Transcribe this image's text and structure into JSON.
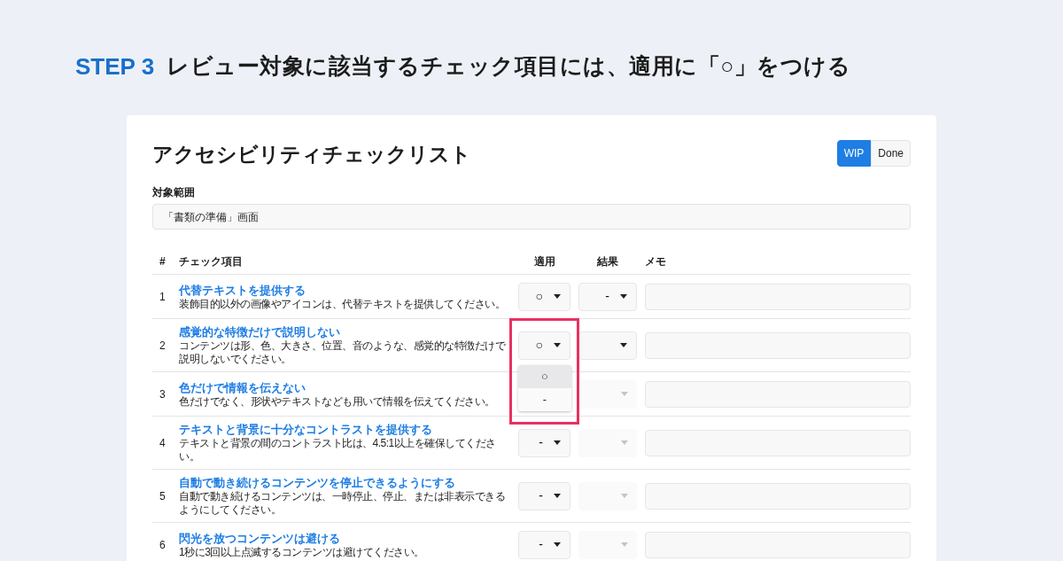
{
  "heading": {
    "step": "STEP 3",
    "text": "レビュー対象に該当するチェック項目には、適用に「○」をつける"
  },
  "card": {
    "title": "アクセシビリティチェックリスト",
    "status_toggle": [
      {
        "label": "WIP",
        "selected": true
      },
      {
        "label": "Done",
        "selected": false
      }
    ],
    "scope": {
      "label": "対象範囲",
      "value": "「書類の準備」画面"
    },
    "columns": [
      "#",
      "チェック項目",
      "適用",
      "結果",
      "メモ"
    ],
    "rows": [
      {
        "number": "1",
        "title": "代替テキストを提供する",
        "description": "装飾目的以外の画像やアイコンは、代替テキストを提供してください。",
        "apply": {
          "value": "○"
        },
        "result": {
          "value": "-",
          "disabled": false
        }
      },
      {
        "number": "2",
        "title": "感覚的な特徴だけで説明しない",
        "description": "コンテンツは形、色、大きさ、位置、音のような、感覚的な特徴だけで説明しないでください。",
        "apply": {
          "value": "○",
          "open": true,
          "highlighted": true,
          "options": [
            {
              "label": "○",
              "selected": true
            },
            {
              "label": "-",
              "selected": false
            }
          ]
        },
        "result": {
          "disabled": false
        }
      },
      {
        "number": "3",
        "title": "色だけで情報を伝えない",
        "description": "色だけでなく、形状やテキストなども用いて情報を伝えてください。",
        "result": {
          "disabled": true
        }
      },
      {
        "number": "4",
        "title": "テキストと背景に十分なコントラストを提供する",
        "description": "テキストと背景の間のコントラスト比は、4.5:1以上を確保してください。",
        "apply": {
          "value": "-"
        },
        "result": {
          "disabled": true
        }
      },
      {
        "number": "5",
        "title": "自動で動き続けるコンテンツを停止できるようにする",
        "description": "自動で動き続けるコンテンツは、一時停止、停止、または非表示できるようにしてください。",
        "apply": {
          "value": "-"
        },
        "result": {
          "disabled": true
        }
      },
      {
        "number": "6",
        "title": "閃光を放つコンテンツは避ける",
        "description": "1秒に3回以上点滅するコンテンツは避けてください。",
        "apply": {
          "value": "-"
        },
        "result": {
          "disabled": true
        }
      }
    ]
  }
}
